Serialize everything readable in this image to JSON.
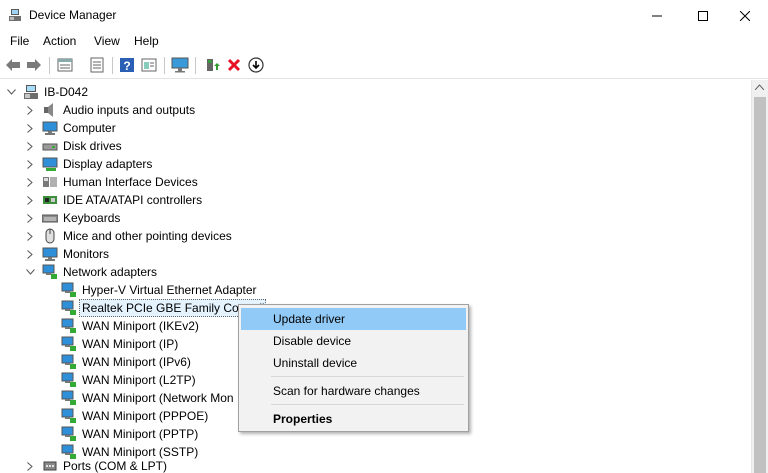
{
  "window": {
    "title": "Device Manager"
  },
  "menu": [
    "File",
    "Action",
    "View",
    "Help"
  ],
  "toolbar": [
    "back-arrow-icon",
    "forward-arrow-icon",
    "properties-icon",
    "list-view-icon",
    "help-icon",
    "scan-icon",
    "monitor-icon",
    "enable-device-icon",
    "uninstall-device-icon",
    "update-driver-icon"
  ],
  "tree": {
    "root": "IB-D042",
    "categories": [
      {
        "label": "Audio inputs and outputs",
        "icon": "speaker-icon"
      },
      {
        "label": "Computer",
        "icon": "computer-icon"
      },
      {
        "label": "Disk drives",
        "icon": "disk-drive-icon"
      },
      {
        "label": "Display adapters",
        "icon": "display-adapter-icon"
      },
      {
        "label": "Human Interface Devices",
        "icon": "hid-icon"
      },
      {
        "label": "IDE ATA/ATAPI controllers",
        "icon": "ide-controller-icon"
      },
      {
        "label": "Keyboards",
        "icon": "keyboard-icon"
      },
      {
        "label": "Mice and other pointing devices",
        "icon": "mouse-icon"
      },
      {
        "label": "Monitors",
        "icon": "monitor-icon"
      },
      {
        "label": "Network adapters",
        "icon": "network-adapter-icon"
      }
    ],
    "network_children": [
      "Hyper-V Virtual Ethernet Adapter",
      "Realtek PCIe GBE Family Controll",
      "WAN Miniport (IKEv2)",
      "WAN Miniport (IP)",
      "WAN Miniport (IPv6)",
      "WAN Miniport (L2TP)",
      "WAN Miniport (Network Mon",
      "WAN Miniport (PPPOE)",
      "WAN Miniport (PPTP)",
      "WAN Miniport (SSTP)"
    ],
    "after": {
      "label": "Ports (COM & LPT)",
      "icon": "port-icon"
    }
  },
  "context_menu": {
    "update": "Update driver",
    "disable": "Disable device",
    "uninstall": "Uninstall device",
    "scan": "Scan for hardware changes",
    "properties": "Properties"
  },
  "colors": {
    "selection": "#e5f3ff",
    "menu_highlight": "#91c9f7",
    "uninstall_red": "#e81123"
  }
}
